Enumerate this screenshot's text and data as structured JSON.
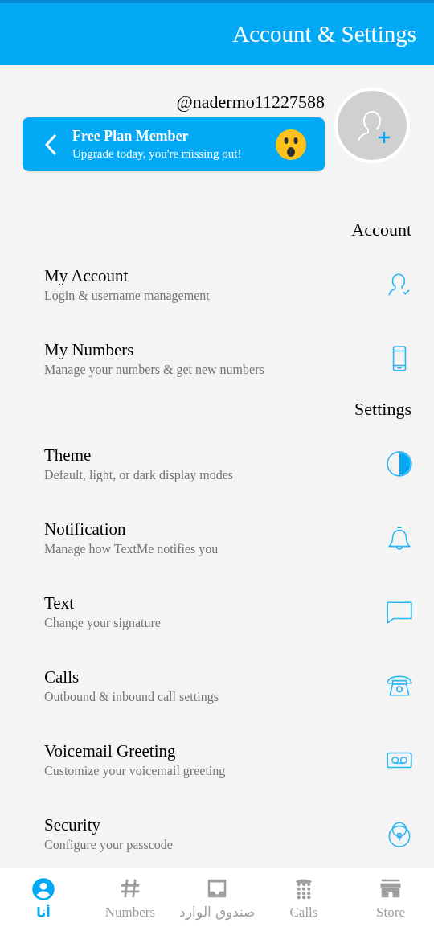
{
  "header": {
    "title": "Account & Settings"
  },
  "profile": {
    "username": "@nadermo11227588",
    "plan_title": "Free Plan Member",
    "plan_subtitle": "Upgrade today, you're missing out!"
  },
  "sections": [
    {
      "title": "Account",
      "items": [
        {
          "title": "My Account",
          "subtitle": "Login & username management",
          "kind": "user"
        },
        {
          "title": "My Numbers",
          "subtitle": "Manage your numbers & get new numbers",
          "kind": "phone"
        }
      ]
    },
    {
      "title": "Settings",
      "items": [
        {
          "title": "Theme",
          "subtitle": "Default, light, or dark display modes",
          "kind": "theme"
        },
        {
          "title": "Notification",
          "subtitle": "Manage how TextMe notifies you",
          "kind": "bell"
        },
        {
          "title": "Text",
          "subtitle": "Change your signature",
          "kind": "chat"
        },
        {
          "title": "Calls",
          "subtitle": "Outbound & inbound call settings",
          "kind": "telephone"
        },
        {
          "title": "Voicemail Greeting",
          "subtitle": "Customize your voicemail greeting",
          "kind": "voicemail"
        },
        {
          "title": "Security",
          "subtitle": "Configure your passcode",
          "kind": "lock"
        }
      ]
    }
  ],
  "nav": [
    {
      "label": "أنا",
      "kind": "me",
      "selected": true
    },
    {
      "label": "Numbers",
      "kind": "hash",
      "selected": false
    },
    {
      "label": "صندوق الوارد",
      "kind": "inbox",
      "selected": false
    },
    {
      "label": "Calls",
      "kind": "dialpad",
      "selected": false
    },
    {
      "label": "Store",
      "kind": "store",
      "selected": false
    }
  ]
}
